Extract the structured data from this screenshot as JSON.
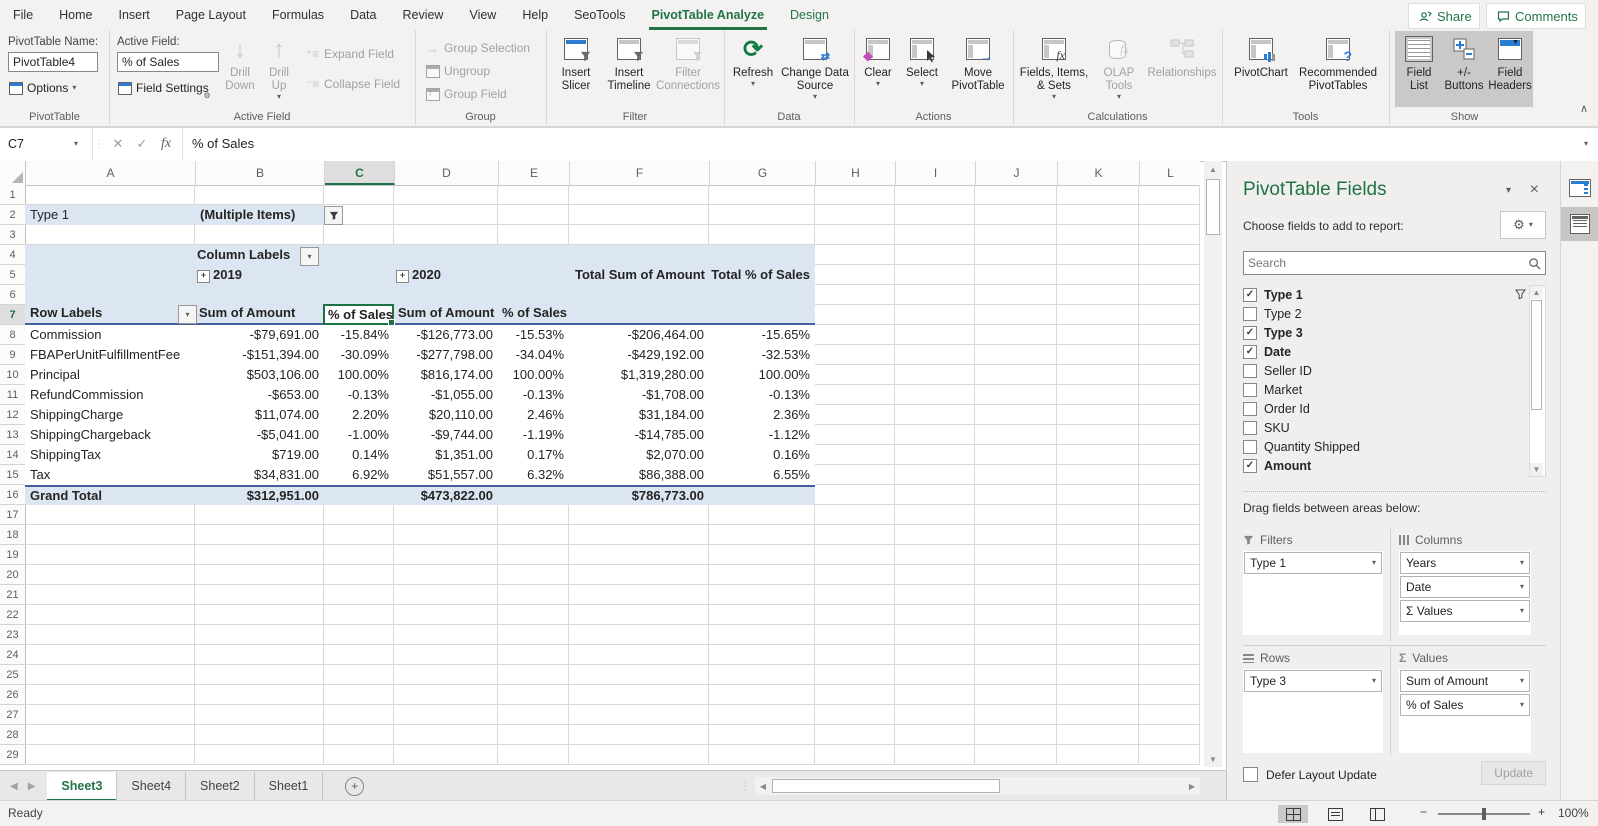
{
  "tab_bar": {
    "tabs": [
      "File",
      "Home",
      "Insert",
      "Page Layout",
      "Formulas",
      "Data",
      "Review",
      "View",
      "Help",
      "SeoTools",
      "PivotTable Analyze",
      "Design"
    ],
    "share": "Share",
    "comments": "Comments"
  },
  "ribbon": {
    "pivottable_group": {
      "name_label": "PivotTable Name:",
      "name_value": "PivotTable4",
      "options_label": "Options",
      "caption": "PivotTable"
    },
    "active_field_group": {
      "label": "Active Field:",
      "field_value": "% of Sales",
      "field_settings": "Field Settings",
      "drill_down": "Drill Down",
      "drill_up": "Drill Up",
      "expand_field": "Expand Field",
      "collapse_field": "Collapse Field",
      "caption": "Active Field"
    },
    "group_group": {
      "group_selection": "Group Selection",
      "ungroup": "Ungroup",
      "group_field": "Group Field",
      "caption": "Group"
    },
    "filter_group": {
      "insert_slicer": "Insert Slicer",
      "insert_timeline": "Insert Timeline",
      "filter_connections": "Filter Connections",
      "caption": "Filter"
    },
    "data_group": {
      "refresh": "Refresh",
      "change_data_source": "Change Data Source",
      "caption": "Data"
    },
    "actions_group": {
      "clear": "Clear",
      "select": "Select",
      "move_pivottable": "Move PivotTable",
      "caption": "Actions"
    },
    "calculations_group": {
      "fields_items_sets": "Fields, Items, & Sets",
      "olap_tools": "OLAP Tools",
      "relationships": "Relationships",
      "caption": "Calculations"
    },
    "tools_group": {
      "pivotchart": "PivotChart",
      "recommended": "Recommended PivotTables",
      "caption": "Tools"
    },
    "show_group": {
      "field_list": "Field List",
      "plusminus": "+/- Buttons",
      "field_headers": "Field Headers",
      "caption": "Show"
    }
  },
  "formula_bar": {
    "name_box": "C7",
    "content": "% of Sales"
  },
  "grid": {
    "column_letters": [
      "A",
      "B",
      "C",
      "D",
      "E",
      "F",
      "G",
      "H",
      "I",
      "J",
      "K",
      "L"
    ],
    "row_numbers": [
      "1",
      "2",
      "3",
      "4",
      "5",
      "6",
      "7",
      "8",
      "9",
      "10",
      "11",
      "12",
      "13",
      "14",
      "15",
      "16",
      "17",
      "18",
      "19",
      "20",
      "21",
      "22",
      "23",
      "24",
      "25",
      "26",
      "27",
      "28",
      "29"
    ]
  },
  "pivot": {
    "filter_label": "Type 1",
    "filter_value": "(Multiple Items)",
    "column_labels": "Column Labels",
    "year_2019": "2019",
    "year_2020": "2020",
    "total_amount_header": "Total Sum of Amount",
    "total_sales_header": "Total % of Sales",
    "row_labels": "Row Labels",
    "sub_headers": {
      "b": "Sum of Amount",
      "c": "% of Sales",
      "d": "Sum of Amount",
      "e": "% of Sales"
    },
    "data_rows": [
      {
        "label": "Commission",
        "b": "-$79,691.00",
        "c": "-15.84%",
        "d": "-$126,773.00",
        "e": "-15.53%",
        "f": "-$206,464.00",
        "g": "-15.65%"
      },
      {
        "label": "FBAPerUnitFulfillmentFee",
        "b": "-$151,394.00",
        "c": "-30.09%",
        "d": "-$277,798.00",
        "e": "-34.04%",
        "f": "-$429,192.00",
        "g": "-32.53%"
      },
      {
        "label": "Principal",
        "b": "$503,106.00",
        "c": "100.00%",
        "d": "$816,174.00",
        "e": "100.00%",
        "f": "$1,319,280.00",
        "g": "100.00%"
      },
      {
        "label": "RefundCommission",
        "b": "-$653.00",
        "c": "-0.13%",
        "d": "-$1,055.00",
        "e": "-0.13%",
        "f": "-$1,708.00",
        "g": "-0.13%"
      },
      {
        "label": "ShippingCharge",
        "b": "$11,074.00",
        "c": "2.20%",
        "d": "$20,110.00",
        "e": "2.46%",
        "f": "$31,184.00",
        "g": "2.36%"
      },
      {
        "label": "ShippingChargeback",
        "b": "-$5,041.00",
        "c": "-1.00%",
        "d": "-$9,744.00",
        "e": "-1.19%",
        "f": "-$14,785.00",
        "g": "-1.12%"
      },
      {
        "label": "ShippingTax",
        "b": "$719.00",
        "c": "0.14%",
        "d": "$1,351.00",
        "e": "0.17%",
        "f": "$2,070.00",
        "g": "0.16%"
      },
      {
        "label": "Tax",
        "b": "$34,831.00",
        "c": "6.92%",
        "d": "$51,557.00",
        "e": "6.32%",
        "f": "$86,388.00",
        "g": "6.55%"
      }
    ],
    "grand_total": {
      "label": "Grand Total",
      "b": "$312,951.00",
      "d": "$473,822.00",
      "f": "$786,773.00"
    },
    "selected_cell_value": "% of Sales"
  },
  "sheet_bar": {
    "tabs": [
      "Sheet3",
      "Sheet4",
      "Sheet2",
      "Sheet1"
    ]
  },
  "status_bar": {
    "status": "Ready",
    "zoom_level": "100%"
  },
  "fields_pane": {
    "title": "PivotTable Fields",
    "choose": "Choose fields to add to report:",
    "search_placeholder": "Search",
    "fields": [
      {
        "label": "Type 1",
        "checked": true,
        "filtered": true
      },
      {
        "label": "Type 2",
        "checked": false
      },
      {
        "label": "Type 3",
        "checked": true
      },
      {
        "label": "Date",
        "checked": true
      },
      {
        "label": "Seller ID",
        "checked": false
      },
      {
        "label": "Market",
        "checked": false
      },
      {
        "label": "Order Id",
        "checked": false
      },
      {
        "label": "SKU",
        "checked": false
      },
      {
        "label": "Quantity Shipped",
        "checked": false
      },
      {
        "label": "Amount",
        "checked": true
      }
    ],
    "drag_hint": "Drag fields between areas below:",
    "areas": {
      "filters": {
        "label": "Filters",
        "items": [
          "Type 1"
        ]
      },
      "columns": {
        "label": "Columns",
        "items": [
          "Years",
          "Date",
          "Σ Values"
        ]
      },
      "rows": {
        "label": "Rows",
        "items": [
          "Type 3"
        ]
      },
      "values": {
        "label": "Values",
        "items": [
          "Sum of Amount",
          "% of Sales"
        ]
      }
    },
    "defer_label": "Defer Layout Update",
    "update_label": "Update"
  }
}
